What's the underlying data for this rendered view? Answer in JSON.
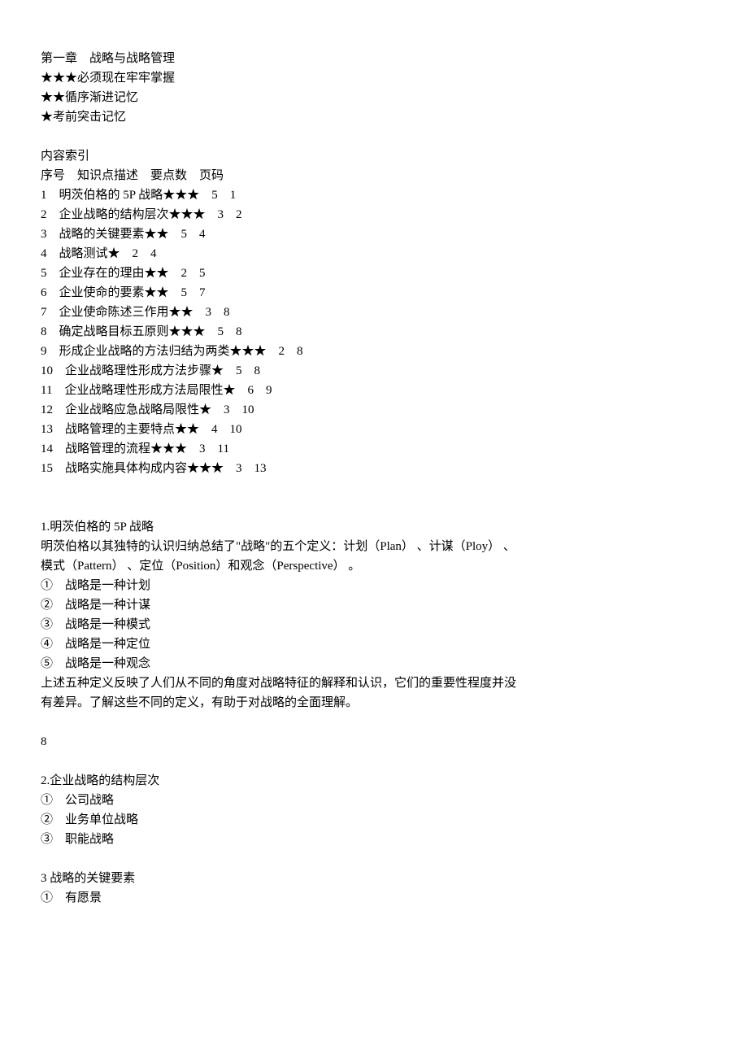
{
  "chapter_title": "第一章    战略与战略管理",
  "legend": [
    "★★★必须现在牢牢掌握",
    "★★循序渐进记忆",
    "★考前突击记忆"
  ],
  "index_title": "内容索引",
  "index_header": "序号    知识点描述    要点数    页码",
  "index": [
    {
      "sn": "1",
      "desc": "明茨伯格的 5P 战略",
      "stars": "★★★",
      "count": "5",
      "page": "1"
    },
    {
      "sn": "2",
      "desc": "企业战略的结构层次",
      "stars": "★★★",
      "count": "3",
      "page": "2"
    },
    {
      "sn": "3",
      "desc": "战略的关键要素",
      "stars": "★★",
      "count": "5",
      "page": "4"
    },
    {
      "sn": "4",
      "desc": "战略测试",
      "stars": "★",
      "count": "2",
      "page": "4"
    },
    {
      "sn": "5",
      "desc": "企业存在的理由",
      "stars": "★★",
      "count": "2",
      "page": "5"
    },
    {
      "sn": "6",
      "desc": "企业使命的要素",
      "stars": "★★",
      "count": "5",
      "page": "7"
    },
    {
      "sn": "7",
      "desc": "企业使命陈述三作用",
      "stars": "★★",
      "count": "3",
      "page": "8"
    },
    {
      "sn": "8",
      "desc": "确定战略目标五原则",
      "stars": "★★★",
      "count": "5",
      "page": "8"
    },
    {
      "sn": "9",
      "desc": "形成企业战略的方法归结为两类",
      "stars": "★★★",
      "count": "2",
      "page": "8"
    },
    {
      "sn": "10",
      "desc": "企业战略理性形成方法步骤",
      "stars": "★",
      "count": "5",
      "page": "8"
    },
    {
      "sn": "11",
      "desc": "企业战略理性形成方法局限性",
      "stars": "★",
      "count": "6",
      "page": "9"
    },
    {
      "sn": "12",
      "desc": "企业战略应急战略局限性",
      "stars": "★",
      "count": "3",
      "page": "10"
    },
    {
      "sn": "13",
      "desc": "战略管理的主要特点",
      "stars": "★★",
      "count": "4",
      "page": "10"
    },
    {
      "sn": "14",
      "desc": "战略管理的流程",
      "stars": "★★★",
      "count": "3",
      "page": "11"
    },
    {
      "sn": "15",
      "desc": "战略实施具体构成内容",
      "stars": "★★★",
      "count": "3",
      "page": "13"
    }
  ],
  "section1": {
    "title": "1.明茨伯格的 5P 战略",
    "intro_line1": "明茨伯格以其独特的认识归纳总结了\"战略\"的五个定义：计划（Plan） 、计谋（Ploy） 、",
    "intro_line2": "模式（Pattern） 、定位（Position）和观念（Perspective） 。",
    "items": [
      "①    战略是一种计划",
      "②    战略是一种计谋",
      "③    战略是一种模式",
      "④    战略是一种定位",
      "⑤    战略是一种观念"
    ],
    "conclusion_line1": "上述五种定义反映了人们从不同的角度对战略特征的解释和认识，它们的重要性程度并没",
    "conclusion_line2": "有差异。了解这些不同的定义，有助于对战略的全面理解。"
  },
  "page_num": "8",
  "section2": {
    "title": "2.企业战略的结构层次",
    "items": [
      "①    公司战略",
      "②    业务单位战略",
      "③    职能战略"
    ]
  },
  "section3": {
    "title": "3 战略的关键要素",
    "items": [
      "①    有愿景"
    ]
  }
}
